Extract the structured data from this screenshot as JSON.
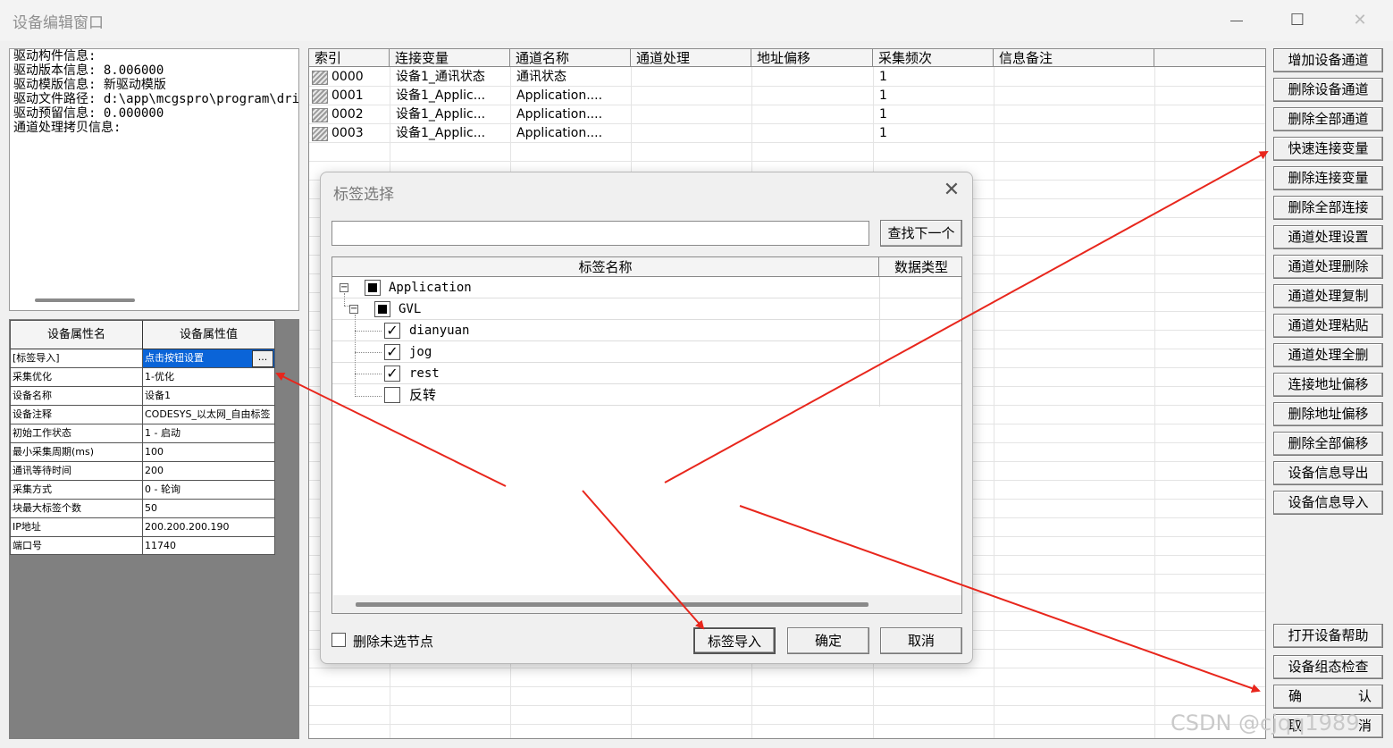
{
  "window": {
    "title": "设备编辑窗口",
    "maximize_glyph": "☐",
    "close_glyph": "✕"
  },
  "info_lines": [
    "驱动构件信息:",
    "驱动版本信息: 8.006000",
    "驱动模版信息: 新驱动模版",
    "驱动文件路径: d:\\app\\mcgspro\\program\\dri",
    "驱动预留信息: 0.000000",
    "通道处理拷贝信息:"
  ],
  "props": {
    "header_name": "设备属性名",
    "header_value": "设备属性值",
    "button_label": "...",
    "rows": [
      {
        "name": "[标签导入]",
        "value": "点击按钮设置"
      },
      {
        "name": "采集优化",
        "value": "1-优化"
      },
      {
        "name": "设备名称",
        "value": "设备1"
      },
      {
        "name": "设备注释",
        "value": "CODESYS_以太网_自由标签"
      },
      {
        "name": "初始工作状态",
        "value": "1 - 启动"
      },
      {
        "name": "最小采集周期(ms)",
        "value": "100"
      },
      {
        "name": "通讯等待时间",
        "value": "200"
      },
      {
        "name": "采集方式",
        "value": "0 - 轮询"
      },
      {
        "name": "块最大标签个数",
        "value": "50"
      },
      {
        "name": "IP地址",
        "value": "200.200.200.190"
      },
      {
        "name": "端口号",
        "value": "11740"
      }
    ]
  },
  "grid": {
    "headers": [
      "索引",
      "连接变量",
      "通道名称",
      "通道处理",
      "地址偏移",
      "采集频次",
      "信息备注"
    ],
    "rows": [
      [
        "0000",
        "设备1_通讯状态",
        "通讯状态",
        "",
        "",
        "1",
        ""
      ],
      [
        "0001",
        "设备1_Applic...",
        "Application....",
        "",
        "",
        "1",
        ""
      ],
      [
        "0002",
        "设备1_Applic...",
        "Application....",
        "",
        "",
        "1",
        ""
      ],
      [
        "0003",
        "设备1_Applic...",
        "Application....",
        "",
        "",
        "1",
        ""
      ]
    ]
  },
  "right_buttons": [
    "增加设备通道",
    "删除设备通道",
    "删除全部通道",
    "快速连接变量",
    "删除连接变量",
    "删除全部连接",
    "通道处理设置",
    "通道处理删除",
    "通道处理复制",
    "通道处理粘贴",
    "通道处理全删",
    "连接地址偏移",
    "删除地址偏移",
    "删除全部偏移",
    "设备信息导出",
    "设备信息导入"
  ],
  "bottom_buttons": {
    "help": "打开设备帮助",
    "check": "设备组态检查",
    "ok_left": "确",
    "ok_right": "认",
    "cancel_left": "取",
    "cancel_right": "消"
  },
  "dialog": {
    "title": "标签选择",
    "close_glyph": "✕",
    "search_value": "",
    "find_next": "查找下一个",
    "col_name": "标签名称",
    "col_type": "数据类型",
    "tree": [
      {
        "label": "Application",
        "level": 0,
        "state": "partial",
        "expander": "−"
      },
      {
        "label": "GVL",
        "level": 1,
        "state": "partial",
        "expander": "−"
      },
      {
        "label": "dianyuan",
        "level": 2,
        "state": "checked"
      },
      {
        "label": "jog",
        "level": 2,
        "state": "checked"
      },
      {
        "label": "rest",
        "level": 2,
        "state": "checked"
      },
      {
        "label": "反转",
        "level": 2,
        "state": "unchecked"
      }
    ],
    "check_glyph": "✓",
    "delete_unselected": "删除未选节点",
    "import_btn": "标签导入",
    "ok_btn": "确定",
    "cancel_btn": "取消"
  },
  "watermark": "CSDN @cjqq1989",
  "colors": {
    "selection": "#0a64d8",
    "arrow": "#e8261c"
  }
}
